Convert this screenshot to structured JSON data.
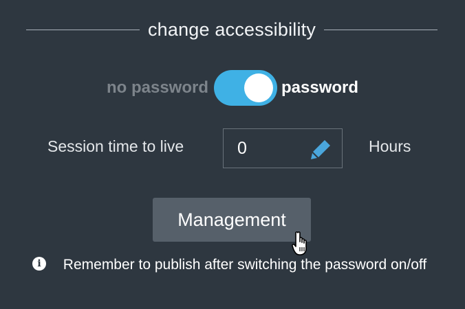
{
  "section": {
    "title": "change accessibility"
  },
  "access_toggle": {
    "off_label": "no password",
    "on_label": "password",
    "state": "on",
    "accent_color": "#3fb1e5"
  },
  "session": {
    "label": "Session time to live",
    "value": "0",
    "unit": "Hours",
    "edit_icon": "pencil-icon"
  },
  "management_button": {
    "label": "Management"
  },
  "note": {
    "icon": "info-icon",
    "text": "Remember to publish after switching the password on/off"
  },
  "colors": {
    "background": "#2e3740",
    "button": "#56606a",
    "muted_text": "#7d848b"
  }
}
